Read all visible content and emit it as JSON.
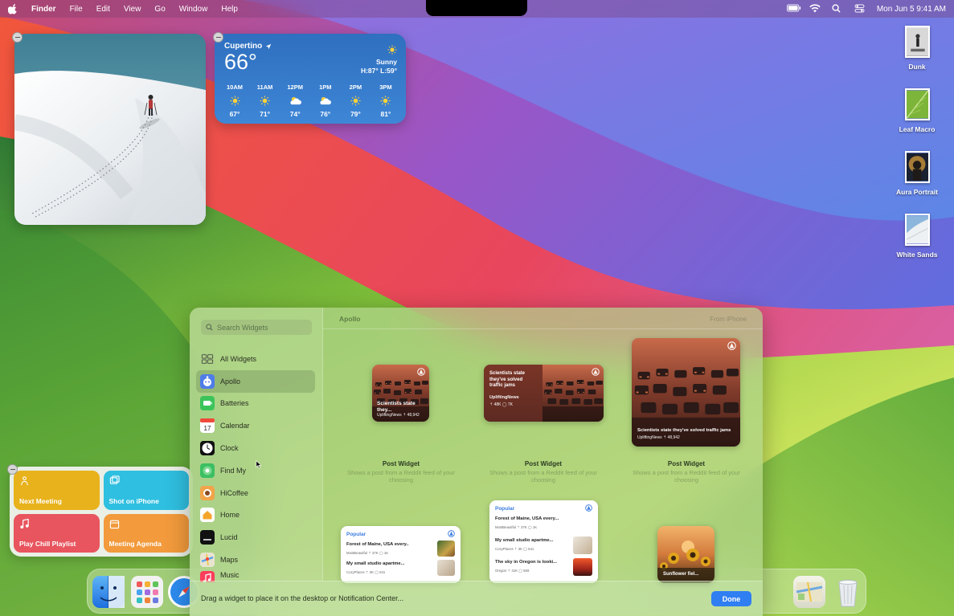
{
  "menubar": {
    "app_name": "Finder",
    "menus": [
      "File",
      "Edit",
      "View",
      "Go",
      "Window",
      "Help"
    ],
    "datetime": "Mon Jun 5  9:41 AM",
    "status_icons": [
      "battery-icon",
      "wifi-icon",
      "search-icon",
      "control-center-icon"
    ]
  },
  "weather": {
    "city": "Cupertino",
    "temperature": "66°",
    "condition": "Sunny",
    "high_low": "H:87° L:59°",
    "hourly": [
      {
        "time": "10AM",
        "icon": "sun-icon",
        "temp": "67°"
      },
      {
        "time": "11AM",
        "icon": "sun-icon",
        "temp": "71°"
      },
      {
        "time": "12PM",
        "icon": "partly-cloudy-icon",
        "temp": "74°"
      },
      {
        "time": "1PM",
        "icon": "partly-cloudy-icon",
        "temp": "76°"
      },
      {
        "time": "2PM",
        "icon": "sun-icon",
        "temp": "79°"
      },
      {
        "time": "3PM",
        "icon": "sun-icon",
        "temp": "81°"
      }
    ]
  },
  "shortcuts": [
    {
      "label": "Next Meeting",
      "color": "#e8b21c",
      "icon": "person-wave-icon"
    },
    {
      "label": "Shot on iPhone",
      "color": "#2fbfe0",
      "icon": "photos-icon"
    },
    {
      "label": "Play Chill Playlist",
      "color": "#e8555e",
      "icon": "music-note-icon"
    },
    {
      "label": "Meeting Agenda",
      "color": "#f29a3c",
      "icon": "calendar-icon"
    }
  ],
  "desktop_icons": [
    {
      "label": "Dunk"
    },
    {
      "label": "Leaf Macro"
    },
    {
      "label": "Aura Portrait"
    },
    {
      "label": "White Sands"
    }
  ],
  "gallery": {
    "search_placeholder": "Search Widgets",
    "sidebar": [
      {
        "label": "All Widgets",
        "icon": "all-widgets-icon"
      },
      {
        "label": "Apollo",
        "icon": "apollo-icon",
        "active": true
      },
      {
        "label": "Batteries",
        "icon": "batteries-icon"
      },
      {
        "label": "Calendar",
        "icon": "calendar-icon"
      },
      {
        "label": "Clock",
        "icon": "clock-icon"
      },
      {
        "label": "Find My",
        "icon": "find-my-icon"
      },
      {
        "label": "HiCoffee",
        "icon": "hicoffee-icon"
      },
      {
        "label": "Home",
        "icon": "home-icon"
      },
      {
        "label": "Lucid",
        "icon": "lucid-icon"
      },
      {
        "label": "Maps",
        "icon": "maps-icon"
      },
      {
        "label": "Music",
        "icon": "music-icon"
      }
    ],
    "main_title": "Apollo",
    "main_right": "From iPhone",
    "post_widgets": [
      {
        "headline_short": "Scientists state they...",
        "meta": "UpliftingNews  ⇡ 48,942",
        "title": "Post Widget",
        "desc": "Shows a post from a Reddit feed of your choosing"
      },
      {
        "headline_lines": [
          "Scientists state",
          "they've solved",
          "traffic jams"
        ],
        "source": "UpliftingNews",
        "meta": "⇡ 48K  ◯ 7K",
        "title": "Post Widget",
        "desc": "Shows a post from a Reddit feed of your choosing"
      },
      {
        "headline": "Scientists state they've solved traffic jams",
        "meta": "UpliftingNews  ⇡ 48,942",
        "title": "Post Widget",
        "desc": "Shows a post from a Reddit feed of your choosing"
      }
    ],
    "popular_small": {
      "header": "Popular",
      "rows": [
        {
          "title": "Forest of Maine, USA every...",
          "sub": "MostBeautiful  ⇡ 37K  ◯ 1K"
        },
        {
          "title": "My small studio apartme...",
          "sub": "CozyPlaces  ⇡ 3K  ◯ 541"
        }
      ]
    },
    "popular_medium": {
      "header": "Popular",
      "rows": [
        {
          "title": "Forest of Maine, USA every...",
          "sub": "MostBeautiful  ⇡ 37K  ◯ 1K"
        },
        {
          "title": "My small studio apartme...",
          "sub": "CozyPlaces  ⇡ 3K  ◯ 541"
        },
        {
          "title": "The sky in Oregon is looki...",
          "sub": "Oregon  ⇡ 41K  ◯ 559"
        }
      ]
    },
    "sunflower_caption": "Sunflower fiel...",
    "footer_hint": "Drag a widget to place it on the desktop or Notification Center...",
    "done_label": "Done"
  }
}
